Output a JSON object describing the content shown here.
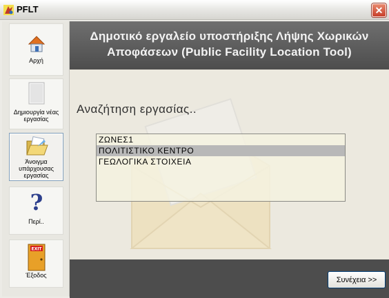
{
  "window": {
    "title": "PFLT"
  },
  "header": {
    "title": "Δημοτικό εργαλείο υποστήριξης Λήψης Χωρικών Αποφάσεων (Public Facility Location Tool)"
  },
  "sidebar": {
    "items": [
      {
        "label": "Αρχή",
        "icon": "home-icon"
      },
      {
        "label": "Δημιουργία νέας εργασίας",
        "icon": "blank-document-icon"
      },
      {
        "label": "Άνοιγμα υπάρχουσας εργασίας",
        "icon": "open-folder-icon"
      },
      {
        "label": "Περί..",
        "icon": "question-mark-icon"
      },
      {
        "label": "Έξοδος",
        "icon": "exit-door-icon"
      }
    ]
  },
  "main": {
    "search_label": "Αναζήτηση εργασίας..",
    "jobs": [
      "ΖΩΝΕΣ1",
      "ΠΟΛΙΤΙΣΤΙΚΟ ΚΕΝΤΡΟ",
      "ΓΕΩΛΟΓΙΚΑ ΣΤΟΙΧΕΙΑ"
    ],
    "selected_job": "ΠΟΛΙΤΙΣΤΙΚΟ ΚΕΝΤΡΟ"
  },
  "footer": {
    "continue_label": "Συνέχεια >>"
  },
  "colors": {
    "header_bg": "#555555",
    "footer_bg": "#4d4d4d",
    "selection": "#b8b8b8",
    "main_bg": "#ece9df"
  }
}
